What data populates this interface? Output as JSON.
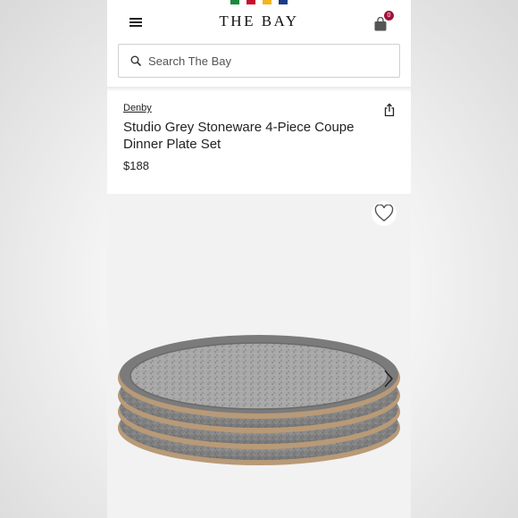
{
  "header": {
    "brand_stripe_colors": [
      "#1a8a3a",
      "#c8102e",
      "#f3b51b",
      "#1b3a8a"
    ],
    "logo_text": "THE BAY",
    "menu_icon": "hamburger-icon",
    "bag_icon": "shopping-bag-icon",
    "bag_count": "0"
  },
  "search": {
    "placeholder": "Search The Bay",
    "icon": "search-icon"
  },
  "product": {
    "brand": "Denby",
    "title": "Studio Grey Stoneware 4-Piece Coupe Dinner Plate Set",
    "price": "$188",
    "share_icon": "share-icon",
    "wishlist_icon": "heart-icon",
    "next_icon": "chevron-right-icon"
  },
  "colors": {
    "accent_red": "#a3123a",
    "text": "#222222",
    "image_bg": "#f2f2f2"
  }
}
